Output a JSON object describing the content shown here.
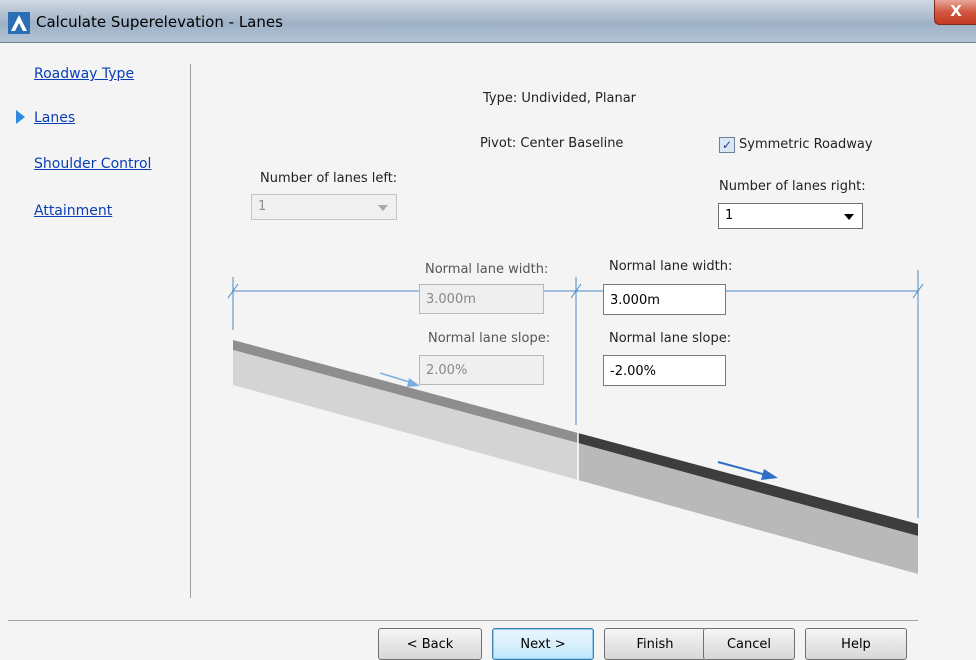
{
  "window": {
    "title": "Calculate Superelevation - Lanes",
    "close_glyph": "X",
    "app_icon": "civil3d-app-icon"
  },
  "nav": {
    "items": [
      {
        "label": "Roadway Type"
      },
      {
        "label": "Lanes",
        "current": true
      },
      {
        "label": "Shoulder Control"
      },
      {
        "label": "Attainment"
      }
    ]
  },
  "info": {
    "type_text": "Type:  Undivided, Planar",
    "pivot_text": "Pivot:  Center Baseline"
  },
  "symmetric": {
    "label": "Symmetric Roadway",
    "checked": true,
    "check_glyph": "✓"
  },
  "lanes_left": {
    "label": "Number of lanes left:",
    "value": "1",
    "enabled": false
  },
  "lanes_right": {
    "label": "Number of lanes right:",
    "value": "1",
    "enabled": true
  },
  "left_lane": {
    "width_label": "Normal lane width:",
    "width_value": "3.000m",
    "slope_label": "Normal lane slope:",
    "slope_value": "2.00%",
    "enabled": false
  },
  "right_lane": {
    "width_label": "Normal lane width:",
    "width_value": "3.000m",
    "slope_label": "Normal lane slope:",
    "slope_value": "-2.00%",
    "enabled": true
  },
  "buttons": {
    "back": "< Back",
    "next": "Next >",
    "finish": "Finish",
    "cancel": "Cancel",
    "help": "Help"
  },
  "colors": {
    "dimension_line": "#4a8ac4",
    "nav_link": "#0a3eb5",
    "nav_arrow": "#2e8ae0",
    "slope_arrow": "#2e6fc4"
  }
}
